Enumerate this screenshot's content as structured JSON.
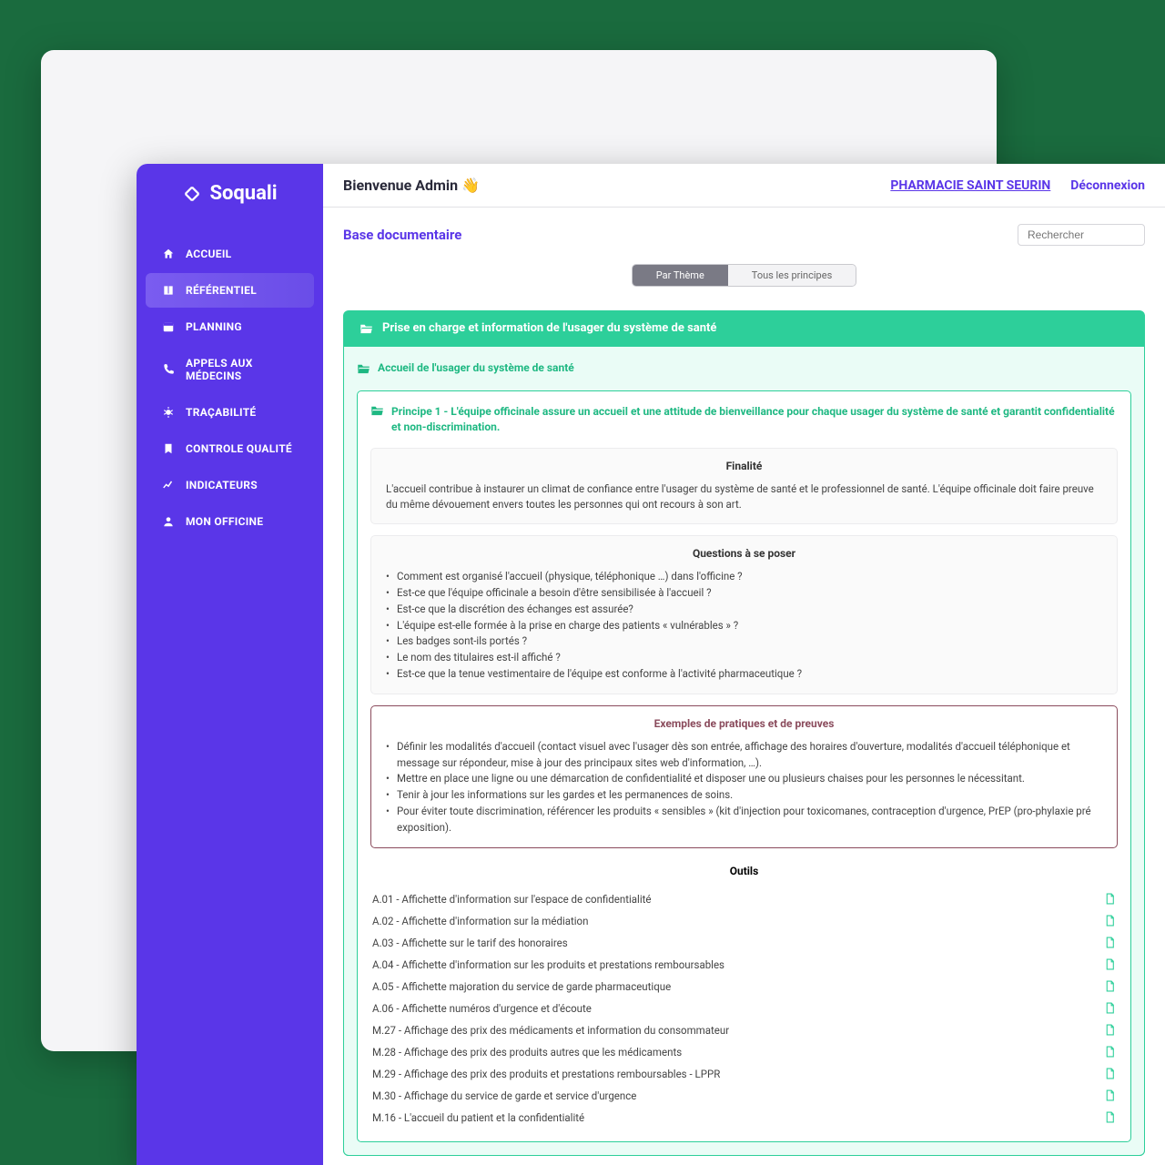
{
  "brand": "Soquali",
  "sidebar": {
    "items": [
      {
        "label": "ACCUEIL"
      },
      {
        "label": "RÉFÉRENTIEL"
      },
      {
        "label": "PLANNING"
      },
      {
        "label": "APPELS AUX MÉDECINS"
      },
      {
        "label": "TRAÇABILITÉ"
      },
      {
        "label": "CONTROLE QUALITÉ"
      },
      {
        "label": "INDICATEURS"
      },
      {
        "label": "MON OFFICINE"
      }
    ]
  },
  "topbar": {
    "welcome": "Bienvenue Admin 👋",
    "pharmacy": "PHARMACIE SAINT SEURIN",
    "logout": "Déconnexion"
  },
  "page": {
    "title": "Base documentaire",
    "search_placeholder": "Rechercher"
  },
  "tabs": {
    "theme": "Par Thème",
    "all": "Tous les principes"
  },
  "section": {
    "title": "Prise en charge et information de l'usager du système de santé",
    "subsection": "Accueil de l'usager du système de santé",
    "principle": "Principe 1 - L'équipe officinale assure un accueil et une attitude de bienveillance pour chaque usager du système de santé et garantit confidentialité et non-discrimination."
  },
  "finalite": {
    "title": "Finalité",
    "text": "L'accueil contribue à instaurer un climat de confiance entre l'usager du système de santé et le professionnel de santé. L'équipe officinale doit faire preuve du même dévouement envers toutes les personnes qui ont recours à son art."
  },
  "questions": {
    "title": "Questions à se poser",
    "items": [
      "Comment est organisé l'accueil (physique, téléphonique …) dans l'officine ?",
      "Est-ce que l'équipe officinale a besoin d'être sensibilisée à l'accueil ?",
      "Est-ce que la discrétion des échanges est assurée?",
      "L'équipe est-elle formée à la prise en charge des patients « vulnérables » ?",
      "Les badges sont-ils portés ?",
      "Le nom des titulaires est-il affiché ?",
      "Est-ce que la tenue vestimentaire de l'équipe est conforme à l'activité pharmaceutique ?"
    ]
  },
  "examples": {
    "title": "Exemples de pratiques et de preuves",
    "items": [
      "Définir les modalités d'accueil (contact visuel avec l'usager dès son entrée, affichage des horaires d'ouverture, modalités d'accueil téléphonique et message sur répondeur, mise à jour des principaux sites web d'information, …).",
      "Mettre en place une ligne ou une démarcation de confidentialité et disposer une ou plusieurs chaises pour les personnes le nécessitant.",
      "Tenir à jour les informations sur les gardes et les permanences de soins.",
      "Pour éviter toute discrimination, référencer les produits « sensibles » (kit d'injection pour toxicomanes, contraception d'urgence, PrEP (pro-phylaxie pré exposition)."
    ]
  },
  "tools": {
    "title": "Outils",
    "items": [
      "A.01 - Affichette d'information sur l'espace de confidentialité",
      "A.02 - Affichette d'information sur la médiation",
      "A.03 - Affichette sur le tarif des honoraires",
      "A.04 - Affichette d'information sur les produits et prestations remboursables",
      "A.05 - Affichette majoration du service de garde pharmaceutique",
      "A.06 - Affichette numéros d'urgence et d'écoute",
      "M.27 - Affichage des prix des médicaments et information du consommateur",
      "M.28 - Affichage des prix des produits autres que les médicaments",
      "M.29 - Affichage des prix des produits et prestations remboursables - LPPR",
      "M.30 - Affichage du service de garde et service d'urgence",
      "M.16 - L'accueil du patient et la confidentialité"
    ]
  }
}
